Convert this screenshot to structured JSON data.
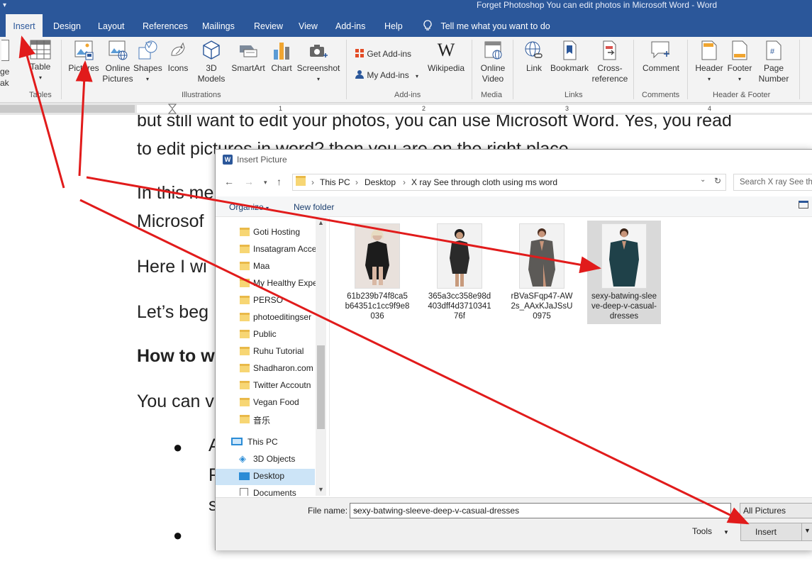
{
  "window": {
    "title": "Forget Photoshop You can edit photos in Microsoft Word  -  Word"
  },
  "tabs": [
    "Insert",
    "Design",
    "Layout",
    "References",
    "Mailings",
    "Review",
    "View",
    "Add-ins",
    "Help"
  ],
  "tell_me": "Tell me what you want to do",
  "ribbon": {
    "partial_left": [
      "ge",
      "ak"
    ],
    "table": "Table",
    "pictures": "Pictures",
    "online_pictures": [
      "Online",
      "Pictures"
    ],
    "shapes": "Shapes",
    "icons": "Icons",
    "models_3d": [
      "3D",
      "Models"
    ],
    "smartart": "SmartArt",
    "chart": "Chart",
    "screenshot": "Screenshot",
    "get_addins": "Get Add-ins",
    "my_addins": "My Add-ins",
    "wikipedia": "Wikipedia",
    "online_video": [
      "Online",
      "Video"
    ],
    "link": "Link",
    "bookmark": "Bookmark",
    "cross_reference": [
      "Cross-",
      "reference"
    ],
    "comment": "Comment",
    "header": "Header",
    "footer": "Footer",
    "page_number": [
      "Page",
      "Number"
    ],
    "groups": {
      "tables": "Tables",
      "illustrations": "Illustrations",
      "addins": "Add-ins",
      "media": "Media",
      "links": "Links",
      "comments": "Comments",
      "header_footer": "Header & Footer"
    }
  },
  "ruler_numbers": [
    "1",
    "2",
    "3",
    "4"
  ],
  "document": {
    "lines": [
      "but still want to edit your photos, you can use Microsoft Word. Yes, you read",
      "to edit pictures in word? then you are on the right place.",
      "In this me",
      "Microsof",
      "Here I wi",
      "Let’s beg",
      "How to w",
      "You can v"
    ],
    "bullet_chars": [
      "A",
      "F",
      "s"
    ]
  },
  "dialog": {
    "title": "Insert Picture",
    "path": [
      "This PC",
      "Desktop",
      "X ray See through cloth using ms word"
    ],
    "search_placeholder": "Search X ray See thr",
    "organize": "Organize",
    "new_folder": "New folder",
    "nav_items": [
      "Goti Hosting",
      "Insatagram Acce",
      "Maa",
      "My Healthy Expe",
      "PERSO",
      "photoeditingser",
      "Public",
      "Ruhu Tutorial",
      "Shadharon.com",
      "Twitter Accoutn",
      "Vegan Food",
      "音乐"
    ],
    "this_pc": "This PC",
    "pc_items": [
      "3D Objects",
      "Desktop",
      "Documents"
    ],
    "files": [
      "61b239b74f8ca5b64351c1cc9f9e8036",
      "365a3cc358e98d403dff4d371034176f",
      "rBVaSFqp47-AW2s_AAxKJaJSsU0975",
      "sexy-batwing-sleeve-deep-v-casual-dresses"
    ],
    "file_name_label": "File name:",
    "file_name_value": "sexy-batwing-sleeve-deep-v-casual-dresses",
    "filter": "All Pictures",
    "tools": "Tools",
    "insert": "Insert"
  },
  "colors": {
    "word_blue": "#2b579a",
    "arrow_red": "#e11b1b",
    "folder_yellow": "#f7d674",
    "selection": "#cce4f7"
  }
}
